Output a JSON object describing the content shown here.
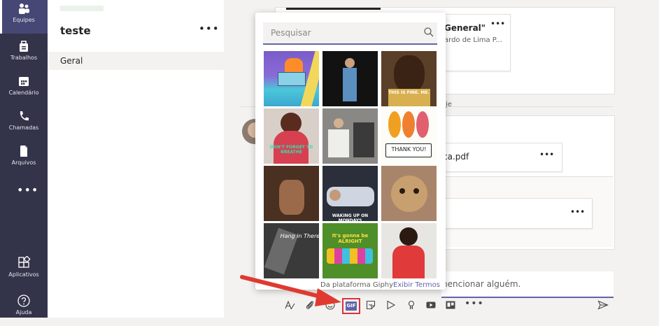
{
  "rail": {
    "items": [
      {
        "label": "Equipes",
        "icon": "teams-icon",
        "active": true
      },
      {
        "label": "Trabalhos",
        "icon": "assignments-icon"
      },
      {
        "label": "Calendário",
        "icon": "calendar-icon"
      },
      {
        "label": "Chamadas",
        "icon": "phone-icon"
      },
      {
        "label": "Arquivos",
        "icon": "files-icon"
      }
    ],
    "more": "•••",
    "bottom": [
      {
        "label": "Aplicativos",
        "icon": "apps-icon"
      },
      {
        "label": "Ajuda",
        "icon": "help-icon"
      }
    ]
  },
  "team": {
    "name": "teste",
    "more": "•••",
    "channel": "Geral"
  },
  "conversation": {
    "card_title": "General\"",
    "card_more": "•••",
    "card_subtitle": "ardo de Lima P...",
    "reply_fragment": "je",
    "file_name": "ca.pdf",
    "file_more": "•••",
    "file2_more": "•••",
    "compose_fragment": "nencionar alguém."
  },
  "gif_picker": {
    "search_placeholder": "Pesquisar",
    "tiles": [
      {
        "caption": ""
      },
      {
        "caption": ""
      },
      {
        "caption": "THIS IS FINE. ME."
      },
      {
        "caption": "DON'T FORGET TO BREATHE"
      },
      {
        "caption": ""
      },
      {
        "caption": "THANK YOU!"
      },
      {
        "caption": ""
      },
      {
        "caption": "WAKING UP ON MONDAYS"
      },
      {
        "caption": ""
      },
      {
        "caption": "Hang in There!"
      },
      {
        "caption": "It's gonna be ALRIGHT"
      },
      {
        "caption": ""
      }
    ],
    "footer_text": "Da plataforma Giphy",
    "footer_link": "Exibir Termos"
  },
  "toolbar": {
    "gif_label": "GIF",
    "more": "•••"
  }
}
